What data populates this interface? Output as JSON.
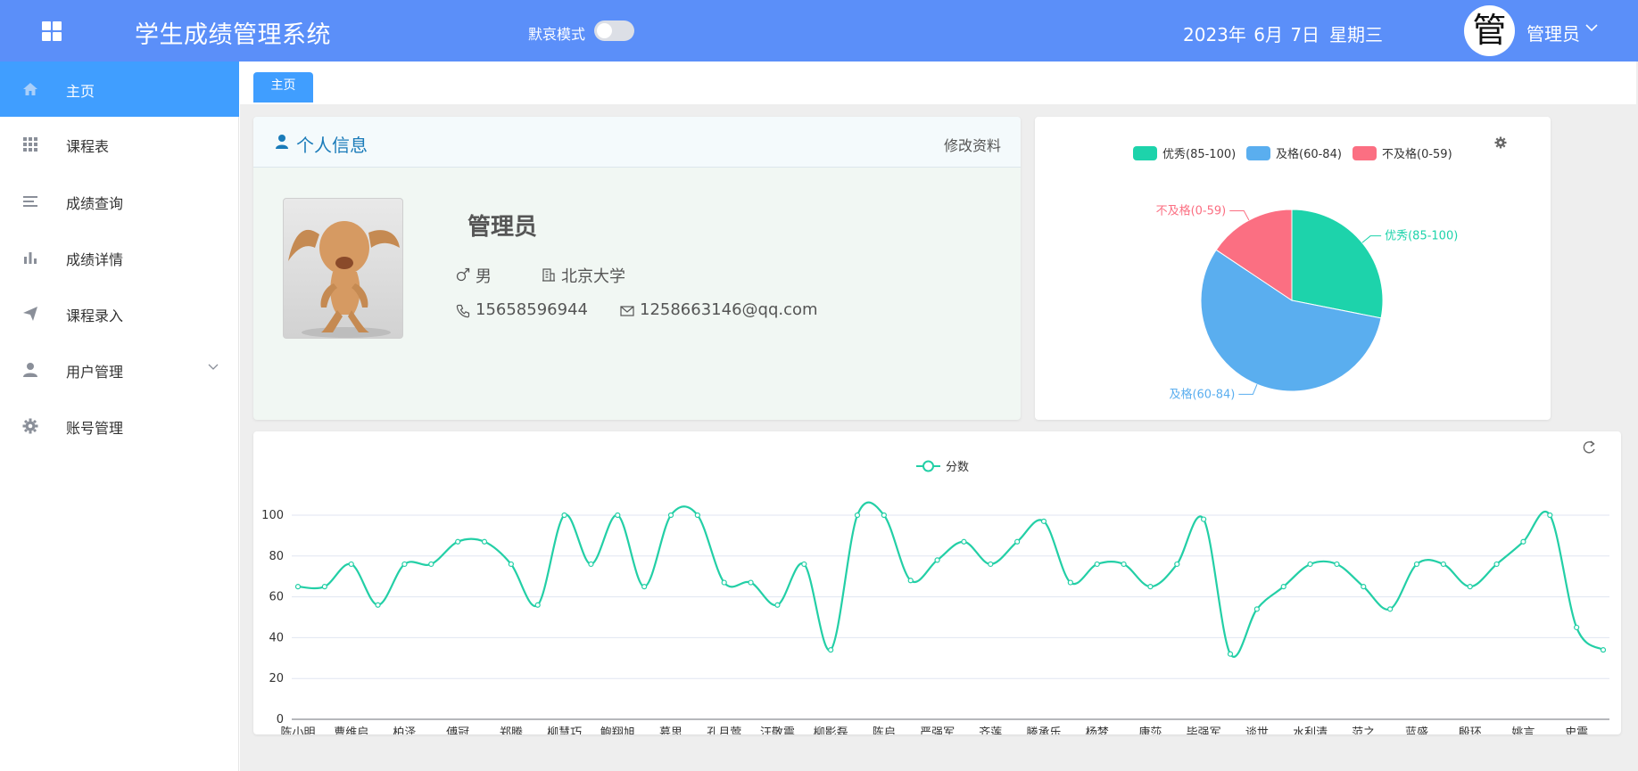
{
  "header": {
    "title": "学生成绩管理系统",
    "mode_label": "默哀模式",
    "date": "2023年 6月 7日",
    "weekday": "星期三",
    "avatar_char": "管",
    "user_name": "管理员"
  },
  "sidebar": {
    "items": [
      {
        "label": "主页",
        "icon": "home-icon"
      },
      {
        "label": "课程表",
        "icon": "grid-icon"
      },
      {
        "label": "成绩查询",
        "icon": "list-icon"
      },
      {
        "label": "成绩详情",
        "icon": "bar-chart-icon"
      },
      {
        "label": "课程录入",
        "icon": "send-icon"
      },
      {
        "label": "用户管理",
        "icon": "user-icon"
      },
      {
        "label": "账号管理",
        "icon": "gear-icon"
      }
    ]
  },
  "tabs": {
    "home": "主页"
  },
  "profile": {
    "section_title": "个人信息",
    "edit_link": "修改资料",
    "name": "管理员",
    "gender": "男",
    "school": "北京大学",
    "phone": "15658596944",
    "email": "1258663146@qq.com"
  },
  "colors": {
    "header": "#5b8ff9",
    "active": "#409eff",
    "excellent": "#1dd3ab",
    "pass": "#5aaeef",
    "fail": "#fb6f82",
    "line": "#23cfa6"
  },
  "chart_data": [
    {
      "type": "pie",
      "legend": [
        "优秀(85-100)",
        "及格(60-84)",
        "不及格(0-59)"
      ],
      "legend_position": "top",
      "labels": [
        "优秀(85-100)",
        "及格(60-84)",
        "不及格(0-59)"
      ],
      "values": [
        9,
        18,
        5
      ],
      "colors": [
        "#1dd3ab",
        "#5aaeef",
        "#fb6f82"
      ],
      "toolbox_icon": "gear-icon"
    },
    {
      "type": "line",
      "legend": [
        "分数"
      ],
      "legend_position": "top",
      "series": [
        {
          "name": "分数",
          "values": [
            65,
            65,
            76,
            56,
            76,
            76,
            87,
            87,
            76,
            56,
            100,
            76,
            100,
            65,
            100,
            100,
            67,
            67,
            56,
            76,
            34,
            100,
            100,
            68,
            78,
            87,
            76,
            87,
            97,
            67,
            76,
            76,
            65,
            76,
            98,
            32,
            54,
            65,
            76,
            76,
            65,
            54,
            76,
            76,
            65,
            76,
            87,
            100,
            45,
            34
          ]
        }
      ],
      "categories": [
        "陈小明",
        "",
        "曹维启",
        "",
        "柏泽",
        "",
        "傅冠",
        "",
        "郑腾",
        "",
        "柳慧巧",
        "",
        "鲍翔旭",
        "",
        "慕思",
        "",
        "孔月莺",
        "",
        "汪敬震",
        "",
        "柳影磊",
        "",
        "陈启",
        "",
        "严强军",
        "",
        "齐莲",
        "",
        "滕承乐",
        "",
        "杨梦",
        "",
        "康莎",
        "",
        "毕强军",
        "",
        "谈世",
        "",
        "水利清",
        "",
        "范之",
        "",
        "蓝盛",
        "",
        "殷环",
        "",
        "姚言",
        "",
        "史震",
        ""
      ],
      "ylim": [
        0,
        100
      ],
      "yticks": [
        0,
        20,
        40,
        60,
        80,
        100
      ],
      "grid": true,
      "toolbox_icon": "refresh-icon"
    }
  ]
}
